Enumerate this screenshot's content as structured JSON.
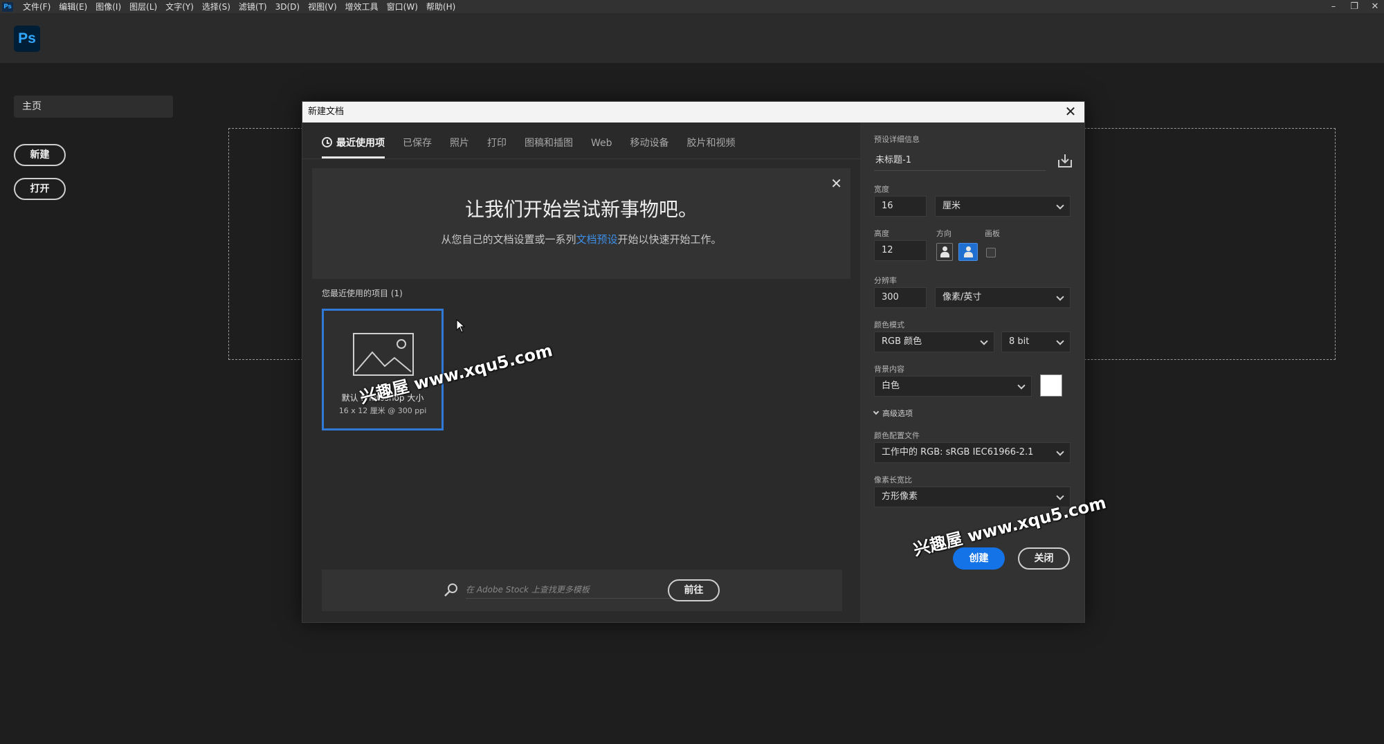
{
  "menubar": {
    "logo": "Ps",
    "items": [
      "文件(F)",
      "编辑(E)",
      "图像(I)",
      "图层(L)",
      "文字(Y)",
      "选择(S)",
      "滤镜(T)",
      "3D(D)",
      "视图(V)",
      "增效工具",
      "窗口(W)",
      "帮助(H)"
    ],
    "controls": [
      "–",
      "❐",
      "✕"
    ]
  },
  "app": {
    "logo": "Ps"
  },
  "sidebar": {
    "home": "主页",
    "new_label": "新建",
    "open_label": "打开"
  },
  "dialog": {
    "title": "新建文档",
    "close": "✕",
    "tabs": [
      "最近使用项",
      "已保存",
      "照片",
      "打印",
      "图稿和插图",
      "Web",
      "移动设备",
      "胶片和视频"
    ],
    "welcome": {
      "title": "让我们开始尝试新事物吧。",
      "sub_before": "从您自己的文档设置或一系列",
      "sub_link": "文档预设",
      "sub_after": "开始以快速开始工作。",
      "close": "✕"
    },
    "recent_label": "您最近使用的项目 (1)",
    "recent_items": [
      {
        "name": "默认 Photoshop 大小",
        "size": "16 x 12 厘米 @ 300 ppi"
      }
    ],
    "search": {
      "placeholder": "在 Adobe Stock 上查找更多模板",
      "go_label": "前往"
    },
    "preset": {
      "section_label": "预设详细信息",
      "name": "未标题-1",
      "width_label": "宽度",
      "width_value": "16",
      "width_unit": "厘米",
      "height_label": "高度",
      "height_value": "12",
      "orientation_label": "方向",
      "artboard_label": "画板",
      "resolution_label": "分辨率",
      "resolution_value": "300",
      "resolution_unit": "像素/英寸",
      "color_mode_label": "颜色模式",
      "color_mode": "RGB 颜色",
      "bit_depth": "8 bit",
      "background_label": "背景内容",
      "background": "白色",
      "background_color": "#ffffff",
      "advanced_label": "高级选项",
      "color_profile_label": "颜色配置文件",
      "color_profile": "工作中的 RGB: sRGB IEC61966-2.1",
      "pixel_aspect_label": "像素长宽比",
      "pixel_aspect": "方形像素",
      "create_label": "创建",
      "close_label": "关闭"
    }
  },
  "watermark": "兴趣屋 www.xqu5.com",
  "colors": {
    "accent": "#1473e6",
    "selection": "#2e7ad6",
    "link": "#3d8ee6"
  }
}
